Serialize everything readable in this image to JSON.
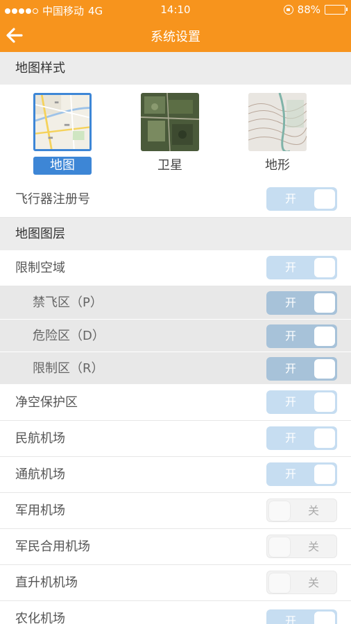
{
  "status": {
    "carrier": "中国移动",
    "network": "4G",
    "time": "14:10",
    "battery": "88%",
    "battery_level": 0.88
  },
  "nav": {
    "title": "系统设置"
  },
  "sections": {
    "map_style": "地图样式",
    "map_layers": "地图图层"
  },
  "map_types": [
    {
      "label": "地图",
      "selected": true
    },
    {
      "label": "卫星",
      "selected": false
    },
    {
      "label": "地形",
      "selected": false
    }
  ],
  "toggle_on": "开",
  "toggle_off": "关",
  "rows": {
    "aircraft_reg": "飞行器注册号",
    "restricted_airspace": "限制空域",
    "no_fly": "禁飞区（P）",
    "danger": "危险区（D）",
    "restricted": "限制区（R）",
    "clearance": "净空保护区",
    "civil_airport": "民航机场",
    "general_airport": "通航机场",
    "military_airport": "军用机场",
    "joint_airport": "军民合用机场",
    "heliport": "直升机机场",
    "agri_airport": "农化机场"
  },
  "colors": {
    "accent": "#f7941d",
    "selected": "#3d86d6",
    "toggle_on": "#c6ddf1"
  }
}
